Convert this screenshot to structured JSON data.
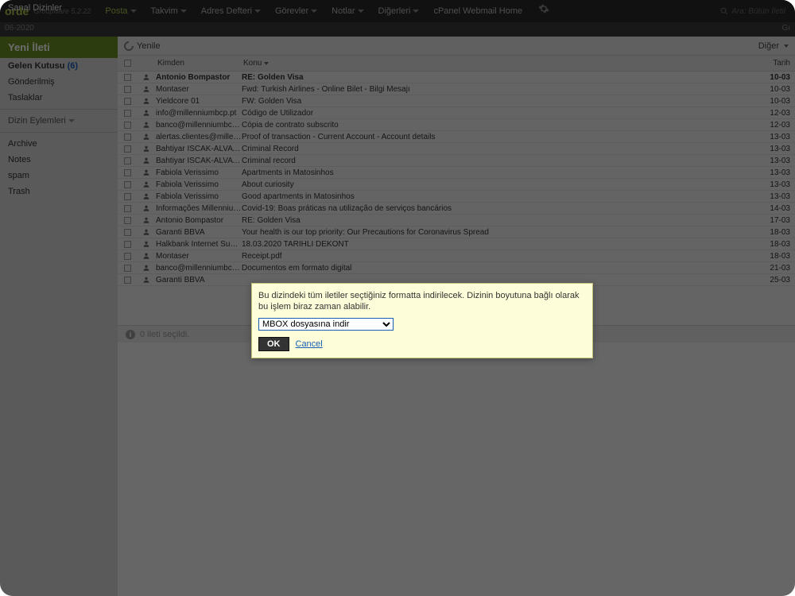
{
  "brand": "orde",
  "groupware": "Groupware 5.2.22",
  "nav": {
    "posta": "Posta",
    "takvim": "Takvim",
    "adres": "Adres Defteri",
    "gorevler": "Görevler",
    "notlar": "Notlar",
    "digerleri": "Diğerleri",
    "cpanel": "cPanel Webmail Home"
  },
  "search_placeholder": "Ara: Bütün İletil",
  "date_label": "06-2020",
  "date_right": "Gı",
  "sidebar": {
    "compose": "Yeni İleti",
    "inbox_label": "Gelen Kutusu",
    "inbox_count": "(6)",
    "sent": "Gönderilmiş",
    "drafts": "Taslaklar",
    "folder_actions": "Dizin Eylemleri",
    "archive": "Archive",
    "notes": "Notes",
    "spam": "spam",
    "trash": "Trash",
    "virtual": "Sanal Dizinler"
  },
  "toolbar": {
    "refresh": "Yenile",
    "other": "Diğer"
  },
  "headers": {
    "from": "Kimden",
    "subject": "Konu",
    "date": "Tarih"
  },
  "messages": [
    {
      "from": "Antonio Bompastor",
      "subject": "RE: Golden Visa",
      "date": "10-03",
      "bold": true
    },
    {
      "from": "Montaser",
      "subject": "Fwd: Turkish Airlines - Online Bilet - Bilgi Mesajı",
      "date": "10-03",
      "bold": false
    },
    {
      "from": "Yieldcore 01",
      "subject": "FW: Golden Visa",
      "date": "10-03",
      "bold": false
    },
    {
      "from": "info@millenniumbcp.pt",
      "subject": "Código de Utilizador",
      "date": "12-03",
      "bold": false
    },
    {
      "from": "banco@millenniumbcp.pt",
      "subject": "Cópia de contrato subscrito",
      "date": "12-03",
      "bold": false
    },
    {
      "from": "alertas.clientes@millenni",
      "subject": "Proof of transaction - Current Account - Account details",
      "date": "13-03",
      "bold": false
    },
    {
      "from": "Bahtiyar ISCAK-ALVATAN",
      "subject": "Criminal Record",
      "date": "13-03",
      "bold": false
    },
    {
      "from": "Bahtiyar ISCAK-ALVATAN",
      "subject": "Criminal record",
      "date": "13-03",
      "bold": false
    },
    {
      "from": "Fabiola Verissimo",
      "subject": "Apartments in Matosinhos",
      "date": "13-03",
      "bold": false
    },
    {
      "from": "Fabiola Verissimo",
      "subject": "About curiosity",
      "date": "13-03",
      "bold": false
    },
    {
      "from": "Fabiola Verissimo",
      "subject": "Good apartments in Matosinhos",
      "date": "13-03",
      "bold": false
    },
    {
      "from": "Informações Millennium bcp",
      "subject": "Covid-19: Boas práticas na utilização de serviços bancários",
      "date": "14-03",
      "bold": false
    },
    {
      "from": "Antonio Bompastor",
      "subject": "RE: Golden Visa",
      "date": "17-03",
      "bold": false
    },
    {
      "from": "Garanti BBVA",
      "subject": "Your health is our top priority: Our Precautions for Coronavirus Spread",
      "date": "18-03",
      "bold": false
    },
    {
      "from": "Halkbank Internet Subesi",
      "subject": "18.03.2020 TARİHLİ DEKONT",
      "date": "18-03",
      "bold": false
    },
    {
      "from": "Montaser",
      "subject": "Receipt.pdf",
      "date": "18-03",
      "bold": false
    },
    {
      "from": "banco@millenniumbcp.pt",
      "subject": "Documentos em formato digital",
      "date": "21-03",
      "bold": false
    },
    {
      "from": "Garanti BBVA",
      "subject": "",
      "date": "25-03",
      "bold": false
    }
  ],
  "status": "0 ileti seçildi.",
  "modal": {
    "message": "Bu dizindeki tüm iletiler seçtiğiniz formatta indirilecek. Dizinin boyutuna bağlı olarak bu işlem biraz zaman alabilir.",
    "select": "MBOX dosyasına indir",
    "ok": "OK",
    "cancel": "Cancel"
  }
}
